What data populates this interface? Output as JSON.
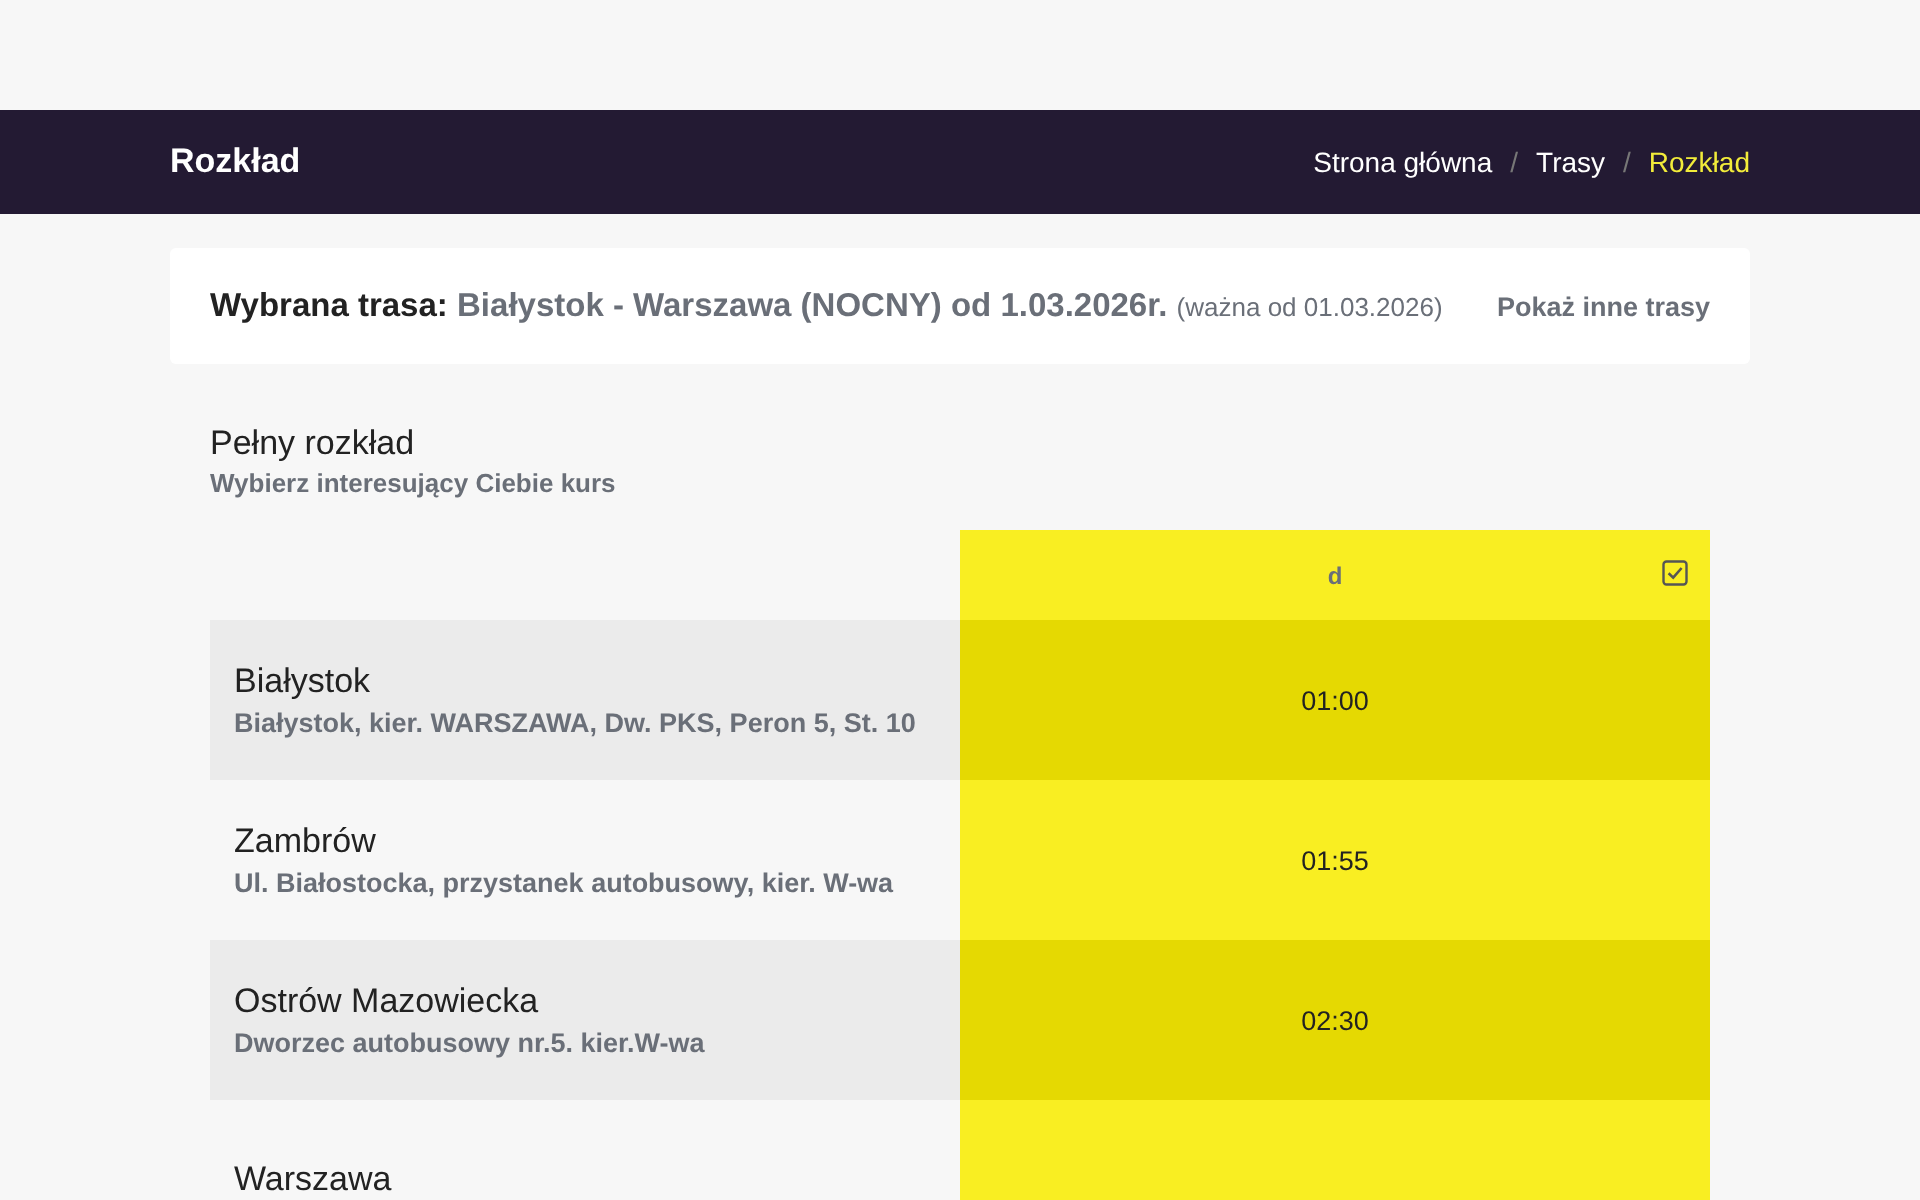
{
  "navbar": {
    "title": "Rozkład",
    "breadcrumbs": [
      {
        "label": "Strona główna",
        "selected": false
      },
      {
        "label": "Trasy",
        "selected": false
      },
      {
        "label": "Rozkład",
        "selected": true
      }
    ],
    "separator": "/"
  },
  "route_card": {
    "label": "Wybrana trasa:",
    "route": "Białystok - Warszawa (NOCNY) od 1.03.2026r.",
    "validity": "(ważna od 01.03.2026)",
    "link": "Pokaż inne trasy"
  },
  "schedule": {
    "title": "Pełny rozkład",
    "subtitle": "Wybierz interesujący Ciebie kurs",
    "course_column": {
      "label": "d",
      "checked": true
    },
    "rows": [
      {
        "stop": "Białystok",
        "details": "Białystok, kier. WARSZAWA, Dw. PKS, Peron 5, St. 10",
        "time": "01:00"
      },
      {
        "stop": "Zambrów",
        "details": "Ul. Białostocka, przystanek autobusowy, kier. W-wa",
        "time": "01:55"
      },
      {
        "stop": "Ostrów Mazowiecka",
        "details": "Dworzec autobusowy nr.5. kier.W-wa",
        "time": "02:30"
      },
      {
        "stop": "Warszawa"
      }
    ]
  }
}
